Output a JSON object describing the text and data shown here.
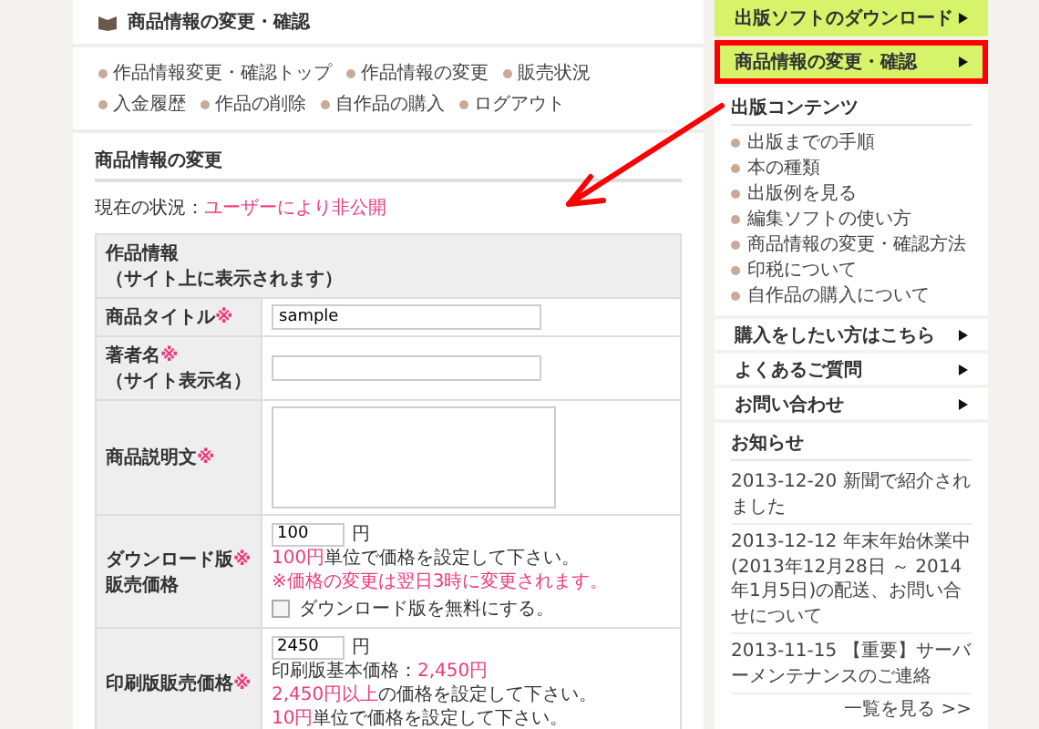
{
  "header": {
    "title": "商品情報の変更・確認"
  },
  "nav_links": [
    "作品情報変更・確認トップ",
    "作品情報の変更",
    "販売状況",
    "入金履歴",
    "作品の削除",
    "自作品の購入",
    "ログアウト"
  ],
  "section_title": "商品情報の変更",
  "status": {
    "label": "現在の状況：",
    "value": "ユーザーにより非公開"
  },
  "form": {
    "heading": [
      "作品情報",
      "（サイト上に表示されます）"
    ],
    "rows": [
      {
        "kind": "text",
        "label": "商品タイトル",
        "required_mark": "※",
        "value": "sample"
      },
      {
        "kind": "text",
        "label": "著者名",
        "required_mark": "※",
        "sublabel": "（サイト表示名）"
      },
      {
        "kind": "textarea",
        "label": "商品説明文",
        "required_mark": "※"
      },
      {
        "kind": "price",
        "label": "ダウンロード版",
        "required_mark": "※",
        "sublabel": "販売価格",
        "value": "100",
        "unit": "円",
        "notes": [
          [
            {
              "text": "100円",
              "highlight": true
            },
            {
              "text": "単位で価格を設定して下さい。",
              "highlight": false
            }
          ],
          [
            {
              "text": "※価格の変更は翌日3時に変更されます。",
              "highlight": true
            }
          ]
        ],
        "checkbox": {
          "label": "ダウンロード版を無料にする。",
          "checked": false
        }
      },
      {
        "kind": "price",
        "label": "印刷版販売価格",
        "required_mark": "※",
        "value": "2450",
        "unit": "円",
        "notes": [
          [
            {
              "text": "印刷版基本価格：",
              "highlight": false
            },
            {
              "text": "2,450円",
              "highlight": true
            }
          ],
          [
            {
              "text": "2,450円以上",
              "highlight": true
            },
            {
              "text": "の価格を設定して下さい。",
              "highlight": false
            }
          ],
          [
            {
              "text": "10円",
              "highlight": true
            },
            {
              "text": "単位で価格を設定して下さい。",
              "highlight": false
            }
          ]
        ]
      }
    ]
  },
  "sidebar": {
    "menu": [
      {
        "label": "出版ソフトのダウンロード",
        "highlighted": false
      },
      {
        "label": "商品情報の変更・確認",
        "highlighted": true
      }
    ],
    "contents": {
      "title": "出版コンテンツ",
      "items": [
        "出版までの手順",
        "本の種類",
        "出版例を見る",
        "編集ソフトの使い方",
        "商品情報の変更・確認方法",
        "印税について",
        "自作品の購入について"
      ]
    },
    "links": [
      "購入をしたい方はこちら",
      "よくあるご質問",
      "お問い合わせ"
    ],
    "news": {
      "title": "お知らせ",
      "items": [
        "2013-12-20 新聞で紹介されました",
        "2013-12-12 年末年始休業中(2013年12月28日 ～ 2014年1月5日)の配送、お問い合せについて",
        "2013-11-15 【重要】サーバーメンテナンスのご連絡"
      ],
      "more": "一覧を見る >>"
    }
  },
  "annotation": {
    "arrow": true
  }
}
